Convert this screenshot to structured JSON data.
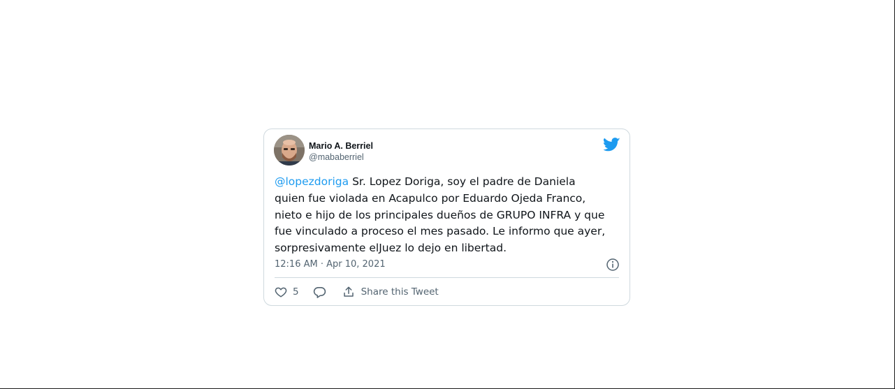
{
  "tweet": {
    "author": {
      "name": "Mario A. Berriel",
      "handle": "@mababerriel"
    },
    "body": {
      "mention": "@lopezdoriga",
      "line1_rest": " Sr. Lopez Doriga, soy el padre de Daniela",
      "line2": "quien fue violada en Acapulco por Eduardo Ojeda Franco,",
      "line3": "nieto e hijo de los principales dueños de GRUPO INFRA y que",
      "line4": "fue vinculado a proceso el mes pasado. Le informo que ayer,",
      "line5": "sorpresivamente elJuez lo dejo en libertad."
    },
    "timestamp": "12:16 AM · Apr 10, 2021",
    "actions": {
      "like_count": "5",
      "share_label": "Share this Tweet"
    }
  },
  "icons": {
    "brand": "twitter-bird-icon",
    "info": "info-icon",
    "like": "heart-icon",
    "reply": "speech-bubble-icon",
    "share": "share-upload-icon"
  },
  "colors": {
    "brand": "#1d9bf0",
    "text": "#0f1419",
    "secondary": "#536471",
    "border": "#cfd9de"
  }
}
